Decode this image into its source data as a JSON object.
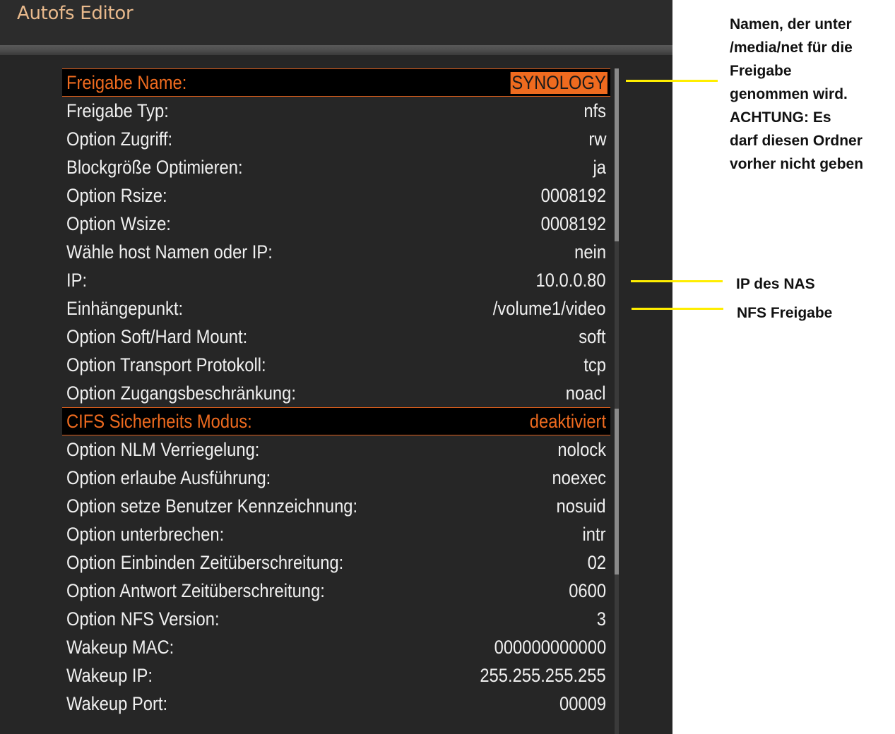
{
  "window": {
    "title": "Autofs Editor"
  },
  "settings": [
    {
      "label": "Freigabe Name:",
      "value": "SYNOLOGY",
      "state": "selected-edit"
    },
    {
      "label": "Freigabe Typ:",
      "value": "nfs"
    },
    {
      "label": "Option Zugriff:",
      "value": "rw"
    },
    {
      "label": "Blockgröße Optimieren:",
      "value": "ja"
    },
    {
      "label": "Option Rsize:",
      "value": "0008192"
    },
    {
      "label": "Option Wsize:",
      "value": "0008192"
    },
    {
      "label": "Wähle host Namen oder IP:",
      "value": "nein"
    },
    {
      "label": "IP:",
      "value": "10.0.0.80"
    },
    {
      "label": "Einhängepunkt:",
      "value": "/volume1/video"
    },
    {
      "label": "Option Soft/Hard Mount:",
      "value": "soft"
    },
    {
      "label": "Option Transport Protokoll:",
      "value": "tcp"
    },
    {
      "label": "Option Zugangsbeschränkung:",
      "value": "noacl"
    },
    {
      "label": "CIFS Sicherheits Modus:",
      "value": "deaktiviert",
      "state": "selected"
    },
    {
      "label": "Option NLM Verriegelung:",
      "value": "nolock"
    },
    {
      "label": "Option erlaube Ausführung:",
      "value": "noexec"
    },
    {
      "label": "Option setze Benutzer Kennzeichnung:",
      "value": "nosuid"
    },
    {
      "label": "Option unterbrechen:",
      "value": "intr"
    },
    {
      "label": "Option Einbinden Zeitüberschreitung:",
      "value": "02"
    },
    {
      "label": "Option Antwort Zeitüberschreitung:",
      "value": "0600"
    },
    {
      "label": "Option NFS Version:",
      "value": "3"
    },
    {
      "label": "Wakeup MAC:",
      "value": "000000000000"
    },
    {
      "label": "Wakeup IP:",
      "value": "255.255.255.255"
    },
    {
      "label": "Wakeup Port:",
      "value": "00009"
    }
  ],
  "annotations": {
    "share_name_note": [
      "Namen, der unter",
      "/media/net für die",
      "Freigabe",
      "genommen wird.",
      "ACHTUNG: Es",
      "darf diesen Ordner",
      "vorher nicht geben"
    ],
    "ip_note": "IP des NAS",
    "mount_note": "NFS Freigabe"
  },
  "colors": {
    "background": "#262626",
    "title_text": "#e8b98c",
    "highlight": "#ef6b1f",
    "annotation_line": "#ffee00",
    "row_text": "#f0f0f0"
  }
}
